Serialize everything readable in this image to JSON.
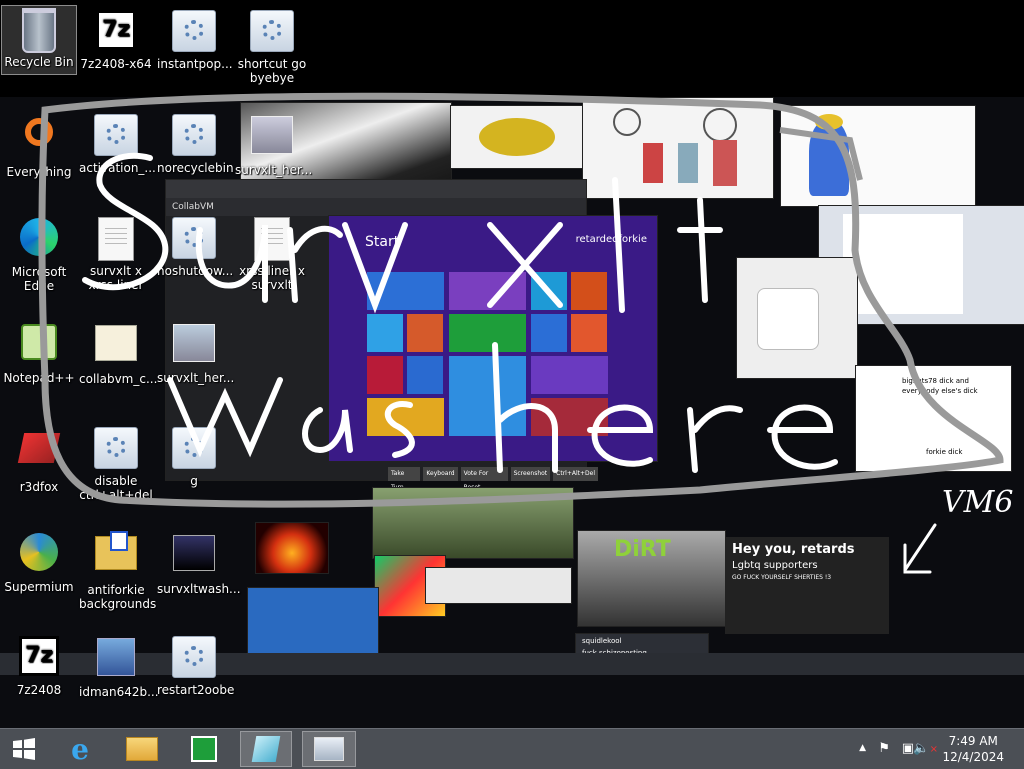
{
  "desktop_icons": [
    {
      "name": "Recycle Bin",
      "selected": true
    },
    {
      "name": "7z2408-x64"
    },
    {
      "name": "instantpop..."
    },
    {
      "name": "shortcut go byebye"
    },
    {
      "name": "Everything"
    },
    {
      "name": "activation_..."
    },
    {
      "name": "norecyclebin"
    },
    {
      "name": "survxlt_her..."
    },
    {
      "name": "Microsoft Edge"
    },
    {
      "name": "survxlt x xrss liner"
    },
    {
      "name": "noshutdow..."
    },
    {
      "name": "xrss liner x survxlt"
    },
    {
      "name": "Notepad++"
    },
    {
      "name": "collabvm_c..."
    },
    {
      "name": "survxlt_her..."
    },
    {
      "name": "r3dfox"
    },
    {
      "name": "disable ctrl+alt+del"
    },
    {
      "name": "g"
    },
    {
      "name": "Supermium"
    },
    {
      "name": "antiforkie backgrounds"
    },
    {
      "name": "survxltwash..."
    },
    {
      "name": "7z2408"
    },
    {
      "name": "idman642b..."
    },
    {
      "name": "restart2oobe"
    }
  ],
  "wallpaper": {
    "collabvm_header": "CollabVM",
    "start_screen_title": "Start",
    "start_screen_user": "retardedforkie",
    "vm_buttons": [
      "Take Turn",
      "Keyboard",
      "Vote For Reset",
      "Screenshot",
      "Ctrl+Alt+Del"
    ],
    "chat_text_1": "bignuts78 dick and everybody else's dick",
    "chat_text_2": "forkie dick",
    "banner_title": "Hey you, retards",
    "banner_sub": "Lgbtq supporters",
    "banner_line": "GO FUCK YOURSELF SHERTIES !3",
    "dirt_logo": "DiRT",
    "chat_user": "squidlekool",
    "chat_msg": "fuck schizoposting"
  },
  "scribble": {
    "line1": "survxlt",
    "line2": "was here",
    "tag": "VM6"
  },
  "taskbar": {
    "buttons": [
      {
        "name": "start",
        "icon": "windows-logo-icon"
      },
      {
        "name": "internet-explorer",
        "icon": "ie-icon"
      },
      {
        "name": "file-explorer",
        "icon": "folder-icon"
      },
      {
        "name": "store",
        "icon": "store-icon"
      },
      {
        "name": "app-1",
        "icon": "glass-icon"
      },
      {
        "name": "app-2",
        "icon": "monitor-icon"
      }
    ],
    "time": "7:49 AM",
    "date": "12/4/2024"
  }
}
